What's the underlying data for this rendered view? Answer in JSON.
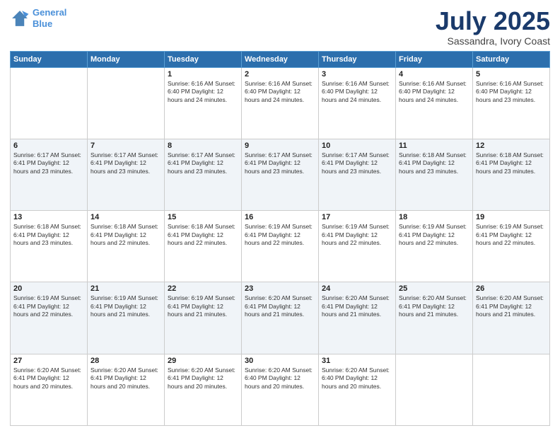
{
  "header": {
    "logo_line1": "General",
    "logo_line2": "Blue",
    "month": "July 2025",
    "location": "Sassandra, Ivory Coast"
  },
  "weekdays": [
    "Sunday",
    "Monday",
    "Tuesday",
    "Wednesday",
    "Thursday",
    "Friday",
    "Saturday"
  ],
  "weeks": [
    [
      {
        "day": "",
        "text": ""
      },
      {
        "day": "",
        "text": ""
      },
      {
        "day": "1",
        "text": "Sunrise: 6:16 AM\nSunset: 6:40 PM\nDaylight: 12 hours\nand 24 minutes."
      },
      {
        "day": "2",
        "text": "Sunrise: 6:16 AM\nSunset: 6:40 PM\nDaylight: 12 hours\nand 24 minutes."
      },
      {
        "day": "3",
        "text": "Sunrise: 6:16 AM\nSunset: 6:40 PM\nDaylight: 12 hours\nand 24 minutes."
      },
      {
        "day": "4",
        "text": "Sunrise: 6:16 AM\nSunset: 6:40 PM\nDaylight: 12 hours\nand 24 minutes."
      },
      {
        "day": "5",
        "text": "Sunrise: 6:16 AM\nSunset: 6:40 PM\nDaylight: 12 hours\nand 23 minutes."
      }
    ],
    [
      {
        "day": "6",
        "text": "Sunrise: 6:17 AM\nSunset: 6:41 PM\nDaylight: 12 hours\nand 23 minutes."
      },
      {
        "day": "7",
        "text": "Sunrise: 6:17 AM\nSunset: 6:41 PM\nDaylight: 12 hours\nand 23 minutes."
      },
      {
        "day": "8",
        "text": "Sunrise: 6:17 AM\nSunset: 6:41 PM\nDaylight: 12 hours\nand 23 minutes."
      },
      {
        "day": "9",
        "text": "Sunrise: 6:17 AM\nSunset: 6:41 PM\nDaylight: 12 hours\nand 23 minutes."
      },
      {
        "day": "10",
        "text": "Sunrise: 6:17 AM\nSunset: 6:41 PM\nDaylight: 12 hours\nand 23 minutes."
      },
      {
        "day": "11",
        "text": "Sunrise: 6:18 AM\nSunset: 6:41 PM\nDaylight: 12 hours\nand 23 minutes."
      },
      {
        "day": "12",
        "text": "Sunrise: 6:18 AM\nSunset: 6:41 PM\nDaylight: 12 hours\nand 23 minutes."
      }
    ],
    [
      {
        "day": "13",
        "text": "Sunrise: 6:18 AM\nSunset: 6:41 PM\nDaylight: 12 hours\nand 23 minutes."
      },
      {
        "day": "14",
        "text": "Sunrise: 6:18 AM\nSunset: 6:41 PM\nDaylight: 12 hours\nand 22 minutes."
      },
      {
        "day": "15",
        "text": "Sunrise: 6:18 AM\nSunset: 6:41 PM\nDaylight: 12 hours\nand 22 minutes."
      },
      {
        "day": "16",
        "text": "Sunrise: 6:19 AM\nSunset: 6:41 PM\nDaylight: 12 hours\nand 22 minutes."
      },
      {
        "day": "17",
        "text": "Sunrise: 6:19 AM\nSunset: 6:41 PM\nDaylight: 12 hours\nand 22 minutes."
      },
      {
        "day": "18",
        "text": "Sunrise: 6:19 AM\nSunset: 6:41 PM\nDaylight: 12 hours\nand 22 minutes."
      },
      {
        "day": "19",
        "text": "Sunrise: 6:19 AM\nSunset: 6:41 PM\nDaylight: 12 hours\nand 22 minutes."
      }
    ],
    [
      {
        "day": "20",
        "text": "Sunrise: 6:19 AM\nSunset: 6:41 PM\nDaylight: 12 hours\nand 22 minutes."
      },
      {
        "day": "21",
        "text": "Sunrise: 6:19 AM\nSunset: 6:41 PM\nDaylight: 12 hours\nand 21 minutes."
      },
      {
        "day": "22",
        "text": "Sunrise: 6:19 AM\nSunset: 6:41 PM\nDaylight: 12 hours\nand 21 minutes."
      },
      {
        "day": "23",
        "text": "Sunrise: 6:20 AM\nSunset: 6:41 PM\nDaylight: 12 hours\nand 21 minutes."
      },
      {
        "day": "24",
        "text": "Sunrise: 6:20 AM\nSunset: 6:41 PM\nDaylight: 12 hours\nand 21 minutes."
      },
      {
        "day": "25",
        "text": "Sunrise: 6:20 AM\nSunset: 6:41 PM\nDaylight: 12 hours\nand 21 minutes."
      },
      {
        "day": "26",
        "text": "Sunrise: 6:20 AM\nSunset: 6:41 PM\nDaylight: 12 hours\nand 21 minutes."
      }
    ],
    [
      {
        "day": "27",
        "text": "Sunrise: 6:20 AM\nSunset: 6:41 PM\nDaylight: 12 hours\nand 20 minutes."
      },
      {
        "day": "28",
        "text": "Sunrise: 6:20 AM\nSunset: 6:41 PM\nDaylight: 12 hours\nand 20 minutes."
      },
      {
        "day": "29",
        "text": "Sunrise: 6:20 AM\nSunset: 6:41 PM\nDaylight: 12 hours\nand 20 minutes."
      },
      {
        "day": "30",
        "text": "Sunrise: 6:20 AM\nSunset: 6:40 PM\nDaylight: 12 hours\nand 20 minutes."
      },
      {
        "day": "31",
        "text": "Sunrise: 6:20 AM\nSunset: 6:40 PM\nDaylight: 12 hours\nand 20 minutes."
      },
      {
        "day": "",
        "text": ""
      },
      {
        "day": "",
        "text": ""
      }
    ]
  ]
}
